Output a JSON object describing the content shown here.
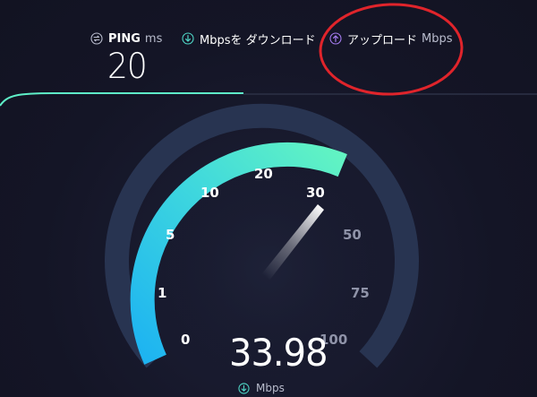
{
  "ping": {
    "label": "PING",
    "unit": "ms",
    "value": "20"
  },
  "download": {
    "label": "Mbpsを ダウンロード"
  },
  "upload": {
    "label": "アップロード",
    "unit": "Mbps"
  },
  "speedometer": {
    "value": "33.98",
    "unit": "Mbps",
    "ticks": [
      "0",
      "1",
      "5",
      "10",
      "20",
      "30",
      "50",
      "75",
      "100"
    ]
  },
  "colors": {
    "background": "#141526",
    "gauge_start": "#1fb7f0",
    "gauge_end": "#5ff5c4",
    "track": "#283451",
    "progress_line": "#5ef0c8",
    "annotation": "#e0242b",
    "upload_icon": "#a57cf0",
    "download_icon": "#4fd7c7"
  },
  "icons": {
    "ping": "ping-arrows-icon",
    "download": "download-arrow-icon",
    "upload": "upload-arrow-icon"
  }
}
